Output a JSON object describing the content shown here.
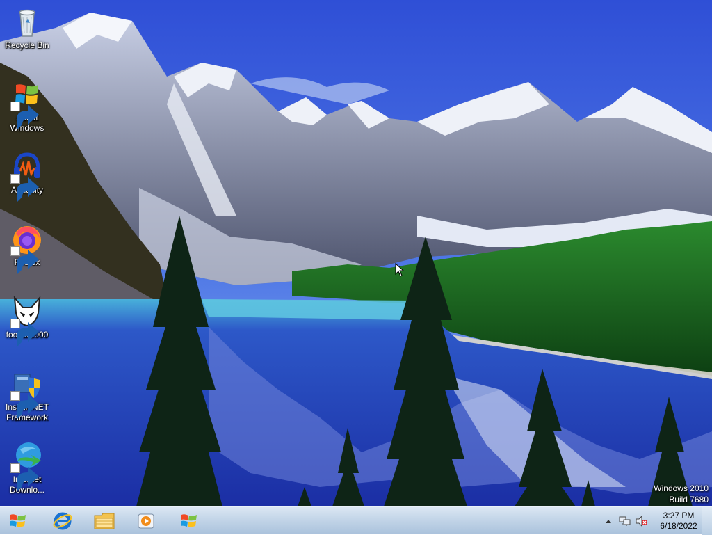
{
  "desktop": {
    "icons": [
      {
        "label": "Recycle Bin",
        "icon": "recycle-bin-icon"
      },
      {
        "label": "About\nWindows",
        "icon": "windows-logo-icon"
      },
      {
        "label": "Audacity",
        "icon": "audacity-icon"
      },
      {
        "label": "Firefox",
        "icon": "firefox-icon"
      },
      {
        "label": "foobar2000",
        "icon": "foobar2000-icon"
      },
      {
        "label": "Install .NET\nFramework",
        "icon": "dotnet-installer-icon"
      },
      {
        "label": "Internet\nDownlo...",
        "icon": "internet-download-manager-icon"
      }
    ],
    "watermark": {
      "line1": "Windows 2010",
      "line2": "Build 7680"
    }
  },
  "taskbar": {
    "start": {
      "icon": "windows-orb-icon"
    },
    "pinned": [
      {
        "icon": "internet-explorer-icon"
      },
      {
        "icon": "file-explorer-icon"
      },
      {
        "icon": "media-player-icon"
      },
      {
        "icon": "windows-logo-icon"
      }
    ],
    "tray": {
      "icons": [
        "show-hidden-icons-arrow",
        "network-icon",
        "volume-muted-icon"
      ],
      "time": "3:27 PM",
      "date": "6/18/2022"
    }
  }
}
